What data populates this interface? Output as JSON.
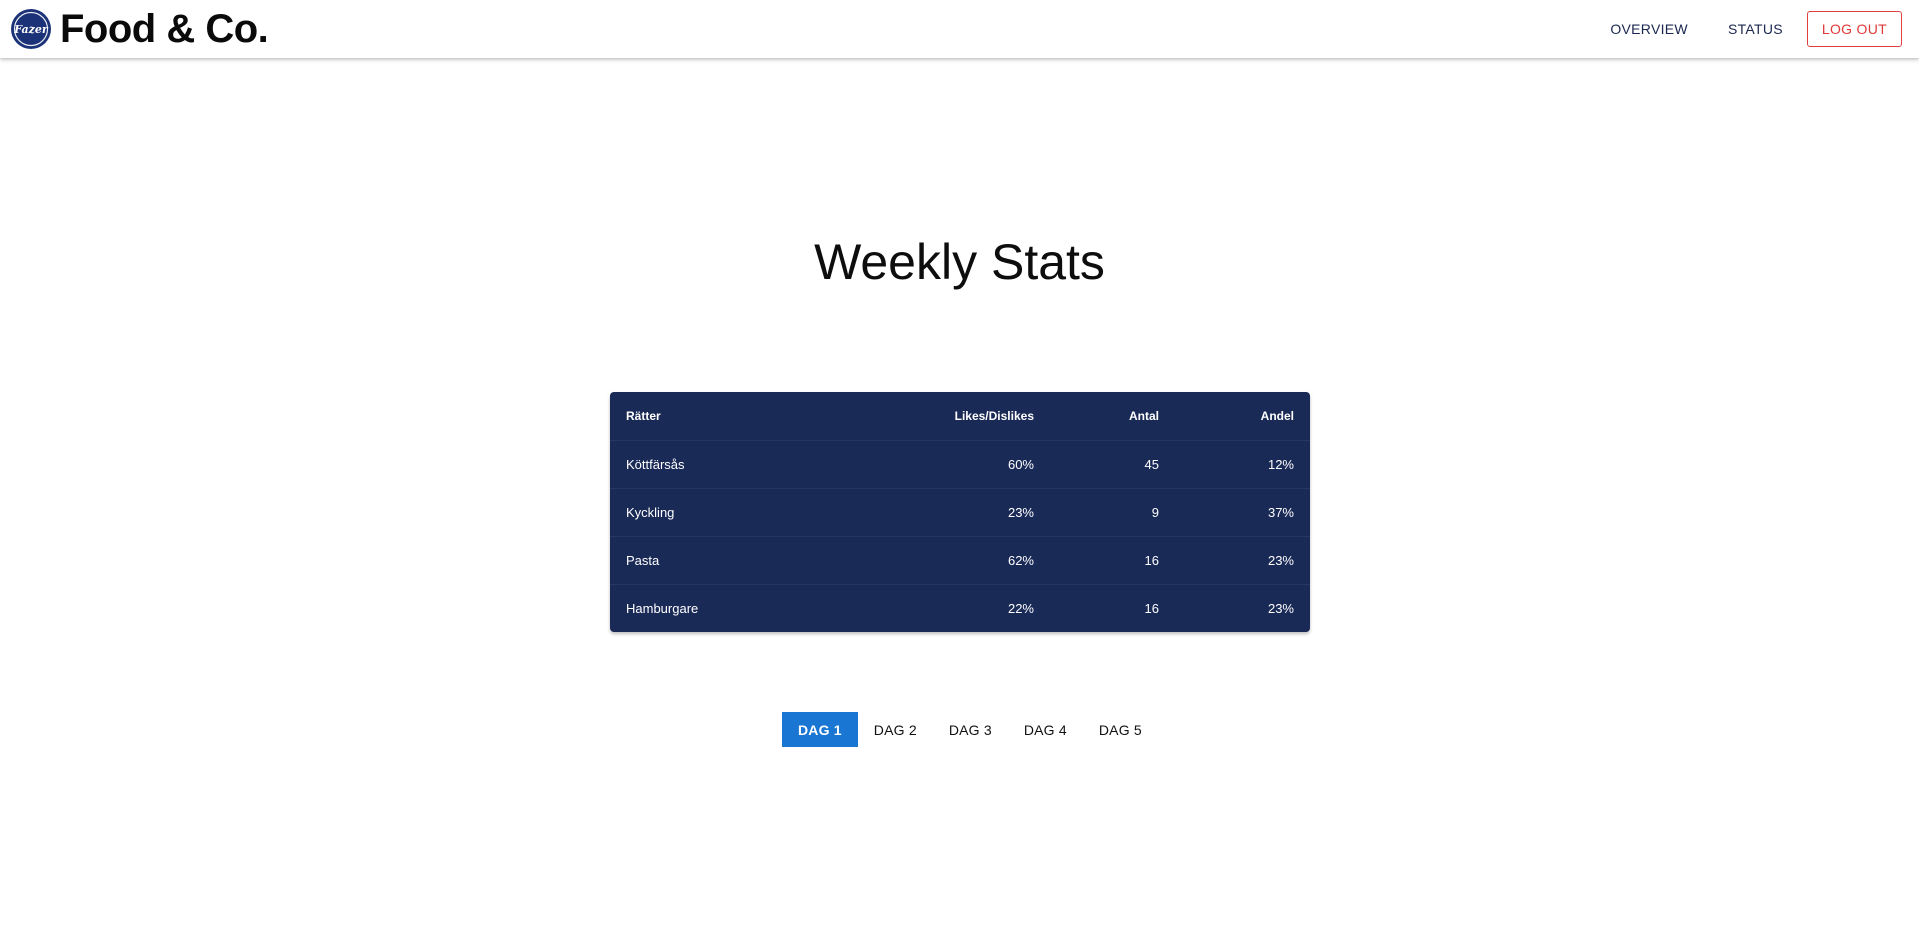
{
  "header": {
    "logo_text": "Fazer",
    "brand_title": "Food & Co.",
    "nav": [
      {
        "label": "OVERVIEW"
      },
      {
        "label": "STATUS"
      }
    ],
    "logout_label": "LOG OUT"
  },
  "main": {
    "title": "Weekly Stats",
    "table": {
      "columns": [
        "Rätter",
        "Likes/Dislikes",
        "Antal",
        "Andel"
      ],
      "rows": [
        [
          "Köttfärsås",
          "60%",
          "45",
          "12%"
        ],
        [
          "Kyckling",
          "23%",
          "9",
          "37%"
        ],
        [
          "Pasta",
          "62%",
          "16",
          "23%"
        ],
        [
          "Hamburgare",
          "22%",
          "16",
          "23%"
        ]
      ]
    },
    "days": [
      {
        "label": "DAG 1",
        "active": true
      },
      {
        "label": "DAG 2",
        "active": false
      },
      {
        "label": "DAG 3",
        "active": false
      },
      {
        "label": "DAG 4",
        "active": false
      },
      {
        "label": "DAG 5",
        "active": false
      }
    ]
  },
  "colors": {
    "table_bg": "#1a2a57",
    "active_day": "#1976d2",
    "logout": "#e03a3a",
    "logo_bg": "#1c3278"
  }
}
